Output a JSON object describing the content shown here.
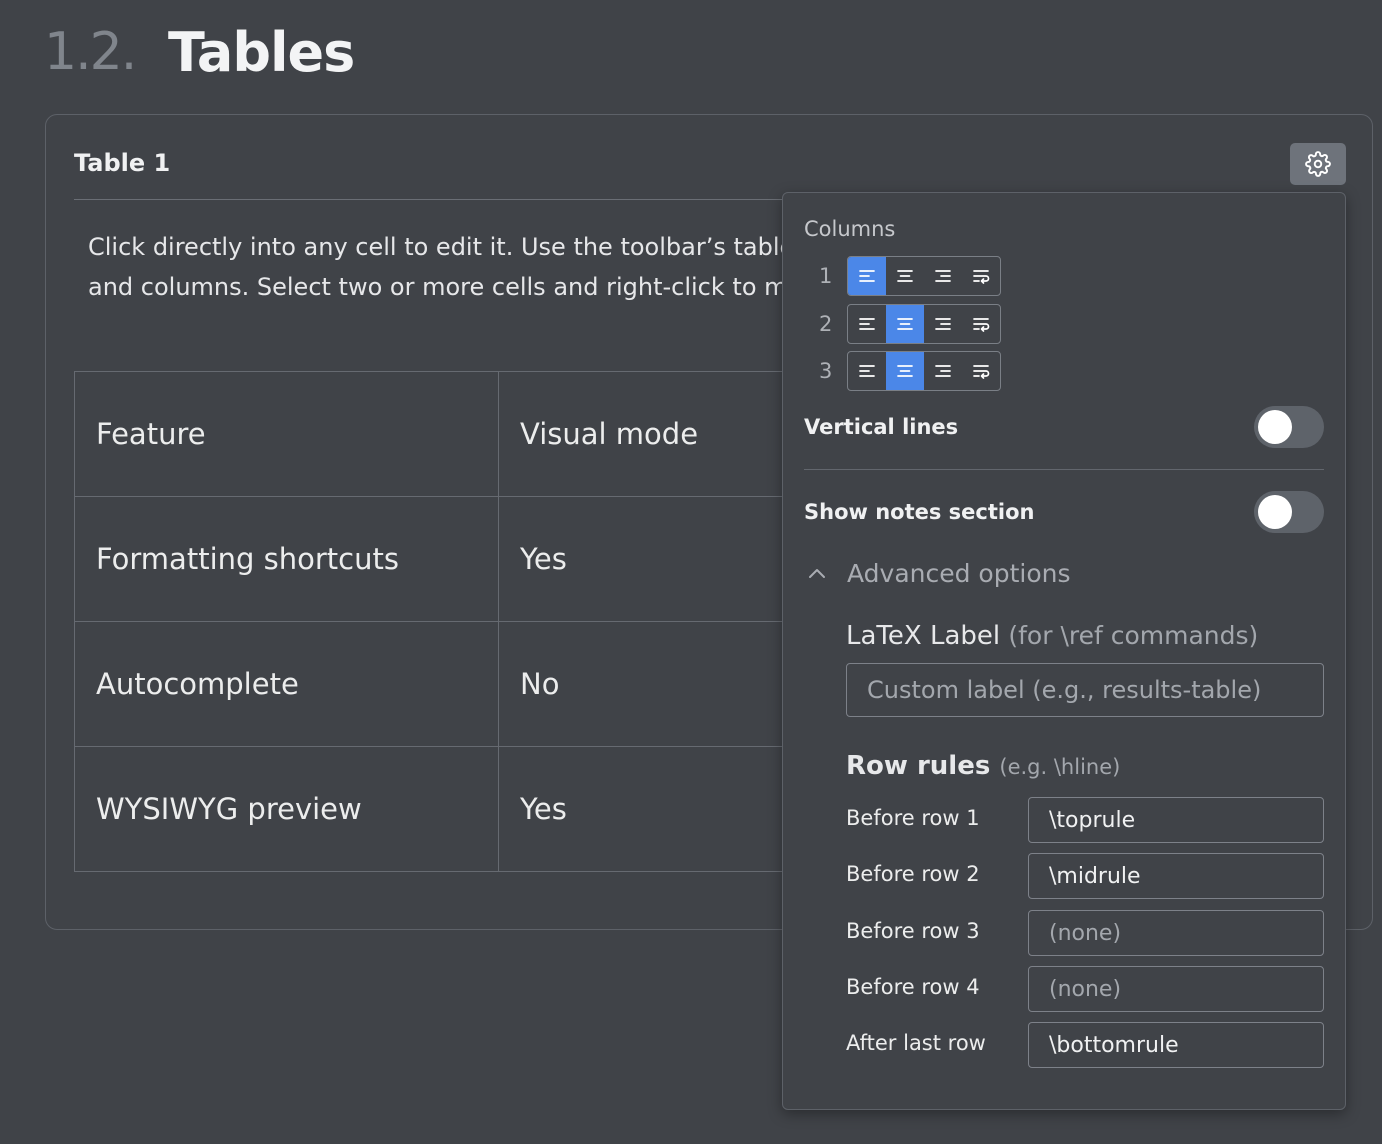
{
  "heading": {
    "number": "1.2.",
    "title": "Tables"
  },
  "card": {
    "title": "Table 1",
    "intro_line1": "Click directly into any cell to edit it. Use the toolbar’s table but",
    "intro_line2": "and columns. Select two or more cells and right-click to merge"
  },
  "table": {
    "rows": [
      [
        "Feature",
        "Visual mode"
      ],
      [
        "Formatting shortcuts",
        "Yes"
      ],
      [
        "Autocomplete",
        "No"
      ],
      [
        "WYSIWYG preview",
        "Yes"
      ]
    ]
  },
  "panel": {
    "columns_label": "Columns",
    "columns": [
      {
        "number": "1",
        "alignment": "left"
      },
      {
        "number": "2",
        "alignment": "center"
      },
      {
        "number": "3",
        "alignment": "center"
      }
    ],
    "alignment_options": [
      "left",
      "center",
      "right",
      "wrap"
    ],
    "vertical_lines": {
      "label": "Vertical lines",
      "enabled": false
    },
    "show_notes": {
      "label": "Show notes section",
      "enabled": false
    },
    "advanced": {
      "label": "Advanced options",
      "expanded": true,
      "latex_label": "LaTeX Label",
      "latex_hint": "(for \\ref commands)",
      "latex_placeholder": "Custom label (e.g., results-table)",
      "latex_value": "",
      "row_rules_label": "Row rules",
      "row_rules_hint": "(e.g. \\hline)",
      "row_rules": [
        {
          "name": "Before row 1",
          "value": "\\toprule",
          "placeholder": ""
        },
        {
          "name": "Before row 2",
          "value": "\\midrule",
          "placeholder": ""
        },
        {
          "name": "Before row 3",
          "value": "",
          "placeholder": "(none)"
        },
        {
          "name": "Before row 4",
          "value": "",
          "placeholder": "(none)"
        },
        {
          "name": "After last row",
          "value": "\\bottomrule",
          "placeholder": ""
        }
      ]
    }
  },
  "colors": {
    "accent": "#4b87e8",
    "background": "#404348"
  }
}
